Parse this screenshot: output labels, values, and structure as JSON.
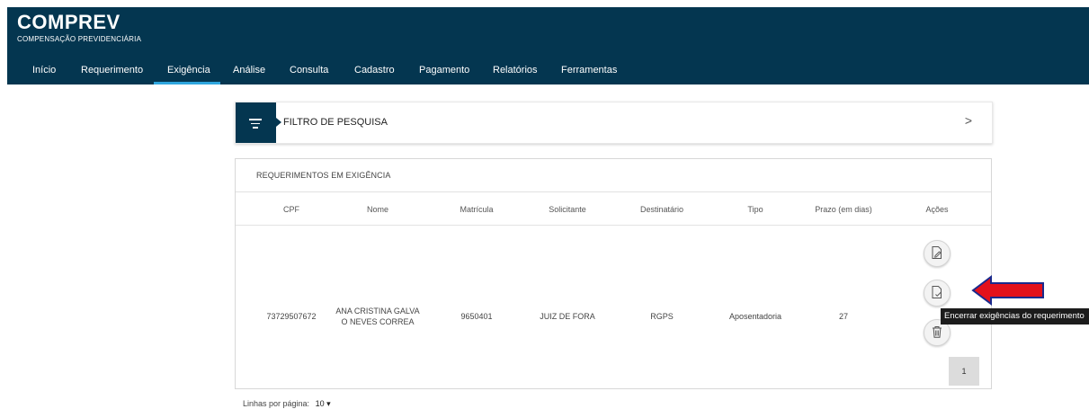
{
  "header": {
    "title": "COMPREV",
    "subtitle": "COMPENSAÇÃO PREVIDENCIÁRIA",
    "nav": [
      "Início",
      "Requerimento",
      "Exigência",
      "Análise",
      "Consulta",
      "Cadastro",
      "Pagamento",
      "Relatórios",
      "Ferramentas"
    ],
    "active_nav": "Exigência"
  },
  "filter": {
    "label": "FILTRO DE PESQUISA",
    "chevron": ">"
  },
  "table": {
    "title": "REQUERIMENTOS EM EXIGÊNCIA",
    "columns": [
      "CPF",
      "Nome",
      "Matrícula",
      "Solicitante",
      "Destinatário",
      "Tipo",
      "Prazo (em dias)",
      "Ações"
    ],
    "rows": [
      {
        "cpf": "73729507672",
        "nome_line1": "ANA CRISTINA GALVA",
        "nome_line2": "O NEVES CORREA",
        "matricula": "9650401",
        "solicitante": "JUIZ DE FORA",
        "destinatario": "RGPS",
        "tipo": "Aposentadoria",
        "prazo": "27"
      }
    ]
  },
  "pagination": {
    "current_page": "1"
  },
  "rows_per_page": {
    "label": "Linhas por página:",
    "value": "10",
    "caret": "▾"
  },
  "tooltip": "Encerrar exigências do requerimento",
  "colors": {
    "header": "#043650",
    "accent": "#2fa6de",
    "arrow": "#e3111b"
  }
}
